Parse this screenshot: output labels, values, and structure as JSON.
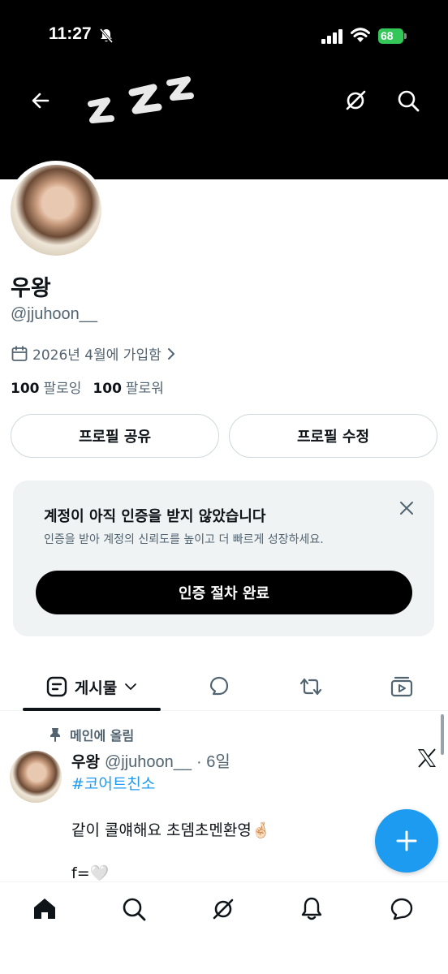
{
  "status_bar": {
    "time": "11:27",
    "battery": "68"
  },
  "profile": {
    "name": "우왕",
    "handle": "@jjuhoon__",
    "joined": "2026년 4월에 가입함",
    "following_count": "100",
    "following_label": "팔로잉",
    "followers_count": "100",
    "followers_label": "팔로워"
  },
  "buttons": {
    "share": "프로필 공유",
    "edit": "프로필 수정"
  },
  "verify": {
    "title": "계정이 아직 인증을 받지 않았습니다",
    "subtitle": "인증을 받아 계정의 신뢰도를 높이고 더 빠르게 성장하세요.",
    "button": "인증 절차 완료"
  },
  "tabs": {
    "posts": "게시물"
  },
  "post": {
    "pinned_label": "메인에 올림",
    "author_name": "우왕",
    "author_handle": "@jjuhoon__",
    "time": "· 6일",
    "hashtag": "#코어트친소",
    "body": "같이 콜얘해요 초뎀초멘환영🤞🏻",
    "sig": "f=🤍"
  },
  "colors": {
    "accent": "#1d9bf0",
    "secondary_text": "#536471",
    "battery": "#33c759"
  },
  "icons": [
    "back-arrow-icon",
    "zzz-icon",
    "grok-icon",
    "search-icon",
    "calendar-icon",
    "chevron-right-icon",
    "close-icon",
    "posts-icon",
    "chevron-down-icon",
    "reply-icon",
    "repost-icon",
    "media-icon",
    "pin-icon",
    "x-logo-icon",
    "plus-icon",
    "home-icon",
    "bell-icon",
    "chat-icon"
  ]
}
